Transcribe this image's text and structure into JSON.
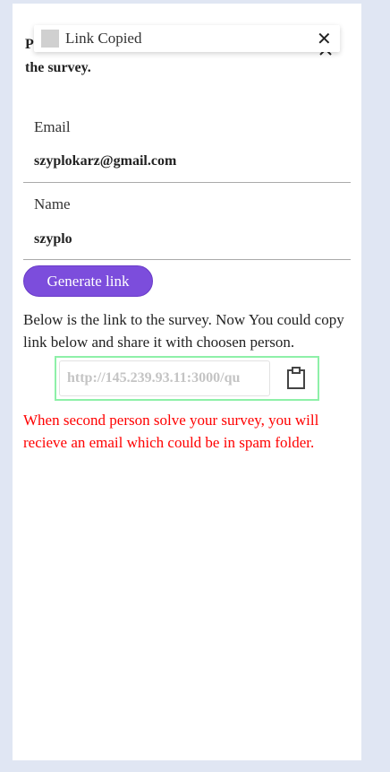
{
  "dialog": {
    "title_prefix": "P",
    "title_line2": "the survey.",
    "close_glyph": "^"
  },
  "toast": {
    "text": "Link Copied",
    "close_glyph": "✕"
  },
  "form": {
    "email_label": "Email",
    "email_value": "szyplokarz@gmail.com",
    "name_label": "Name",
    "name_value": "szyplo"
  },
  "generate_button": "Generate link",
  "description": "Below is the link to the survey. Now You could copy link below and share it with choosen person.",
  "link_input": {
    "value": "http://145.239.93.11:3000/qu"
  },
  "warning": "When second person solve your survey, you will recieve an email which could be in spam folder.",
  "colors": {
    "accent": "#7c4ddc",
    "warning": "#ff0000",
    "highlight_border": "#8ef0a8",
    "background": "#e0e6f3"
  },
  "icons": {
    "copy": "clipboard-icon",
    "toast_close": "close-icon",
    "dialog_close": "chevron-up-icon"
  }
}
